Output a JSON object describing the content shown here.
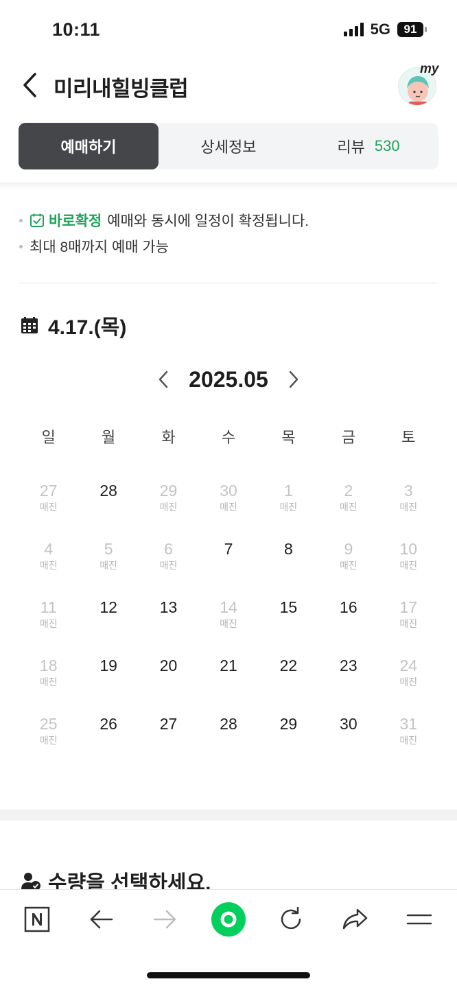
{
  "status_bar": {
    "time": "10:11",
    "network": "5G",
    "battery": "91"
  },
  "header": {
    "title": "미리내힐빙클럽",
    "my_label": "my"
  },
  "tabs": [
    {
      "label": "예매하기",
      "active": true
    },
    {
      "label": "상세정보",
      "active": false
    },
    {
      "label": "리뷰",
      "count": "530",
      "active": false
    }
  ],
  "notices": {
    "confirm_label": "바로확정",
    "confirm_text": "예매와 동시에 일정이 확정됩니다.",
    "limit_text": "최대 8매까지 예매 가능"
  },
  "selected_date": "4.17.(목)",
  "calendar": {
    "month_label": "2025.05",
    "weekdays": [
      "일",
      "월",
      "화",
      "수",
      "목",
      "금",
      "토"
    ],
    "sold_out_label": "매진",
    "days": [
      {
        "d": "27",
        "sold": true
      },
      {
        "d": "28",
        "sold": false
      },
      {
        "d": "29",
        "sold": true
      },
      {
        "d": "30",
        "sold": true
      },
      {
        "d": "1",
        "sold": true
      },
      {
        "d": "2",
        "sold": true
      },
      {
        "d": "3",
        "sold": true
      },
      {
        "d": "4",
        "sold": true
      },
      {
        "d": "5",
        "sold": true
      },
      {
        "d": "6",
        "sold": true
      },
      {
        "d": "7",
        "sold": false
      },
      {
        "d": "8",
        "sold": false
      },
      {
        "d": "9",
        "sold": true
      },
      {
        "d": "10",
        "sold": true
      },
      {
        "d": "11",
        "sold": true
      },
      {
        "d": "12",
        "sold": false
      },
      {
        "d": "13",
        "sold": false
      },
      {
        "d": "14",
        "sold": true
      },
      {
        "d": "15",
        "sold": false
      },
      {
        "d": "16",
        "sold": false
      },
      {
        "d": "17",
        "sold": true
      },
      {
        "d": "18",
        "sold": true
      },
      {
        "d": "19",
        "sold": false
      },
      {
        "d": "20",
        "sold": false
      },
      {
        "d": "21",
        "sold": false
      },
      {
        "d": "22",
        "sold": false
      },
      {
        "d": "23",
        "sold": false
      },
      {
        "d": "24",
        "sold": true
      },
      {
        "d": "25",
        "sold": true
      },
      {
        "d": "26",
        "sold": false
      },
      {
        "d": "27",
        "sold": false
      },
      {
        "d": "28",
        "sold": false
      },
      {
        "d": "29",
        "sold": false
      },
      {
        "d": "30",
        "sold": false
      },
      {
        "d": "31",
        "sold": true
      }
    ]
  },
  "quantity_heading": "수량을 선택하세요.",
  "colors": {
    "accent_green": "#1fa25a",
    "active_tab": "#444649",
    "toolbar_green": "#03cf5d"
  },
  "toolbar": [
    "naver-icon",
    "back-arrow-icon",
    "forward-arrow-icon",
    "green-home-icon",
    "refresh-icon",
    "share-icon",
    "menu-icon"
  ]
}
